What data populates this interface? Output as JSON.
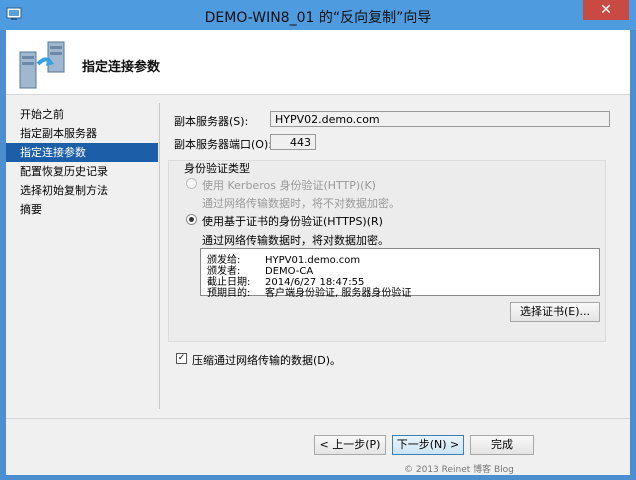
{
  "window": {
    "title": "DEMO-WIN8_01 的“反向复制”向导",
    "close_symbol": "✕"
  },
  "header": {
    "heading": "指定连接参数",
    "icon": "server-replication-icon"
  },
  "nav": {
    "items": [
      {
        "label": "开始之前",
        "active": false
      },
      {
        "label": "指定副本服务器",
        "active": false
      },
      {
        "label": "指定连接参数",
        "active": true
      },
      {
        "label": "配置恢复历史记录",
        "active": false
      },
      {
        "label": "选择初始复制方法",
        "active": false
      },
      {
        "label": "摘要",
        "active": false
      }
    ]
  },
  "form": {
    "replica_server_label": "副本服务器(S):",
    "replica_server_value": "HYPV02.demo.com",
    "replica_port_label": "副本服务器端口(O):",
    "replica_port_value": "443",
    "auth_group_label": "身份验证类型",
    "kerberos_label": "使用 Kerberos 身份验证(HTTP)(K)",
    "kerberos_desc": "通过网络传输数据时，将不对数据加密。",
    "cert_label": "使用基于证书的身份验证(HTTPS)(R)",
    "cert_desc": "通过网络传输数据时，将对数据加密。",
    "cert_info": {
      "issued_to_key": "颁发给:",
      "issued_to_value": "HYPV01.demo.com",
      "issuer_key": "颁发者:",
      "issuer_value": "DEMO-CA",
      "expiry_key": "截止日期:",
      "expiry_value": "2014/6/27 18:47:55",
      "purpose_key": "预期目的:",
      "purpose_value": "客户端身份验证, 服务器身份验证"
    },
    "select_cert_button": "选择证书(E)...",
    "compress_label": "压缩通过网络传输的数据(D)。",
    "compress_checked": true
  },
  "footer": {
    "prev_button": "< 上一步(P)",
    "next_button": "下一步(N) >",
    "finish_button": "完成"
  },
  "watermark": {
    "text": "© 2013 Reinet 博客 Blog"
  }
}
